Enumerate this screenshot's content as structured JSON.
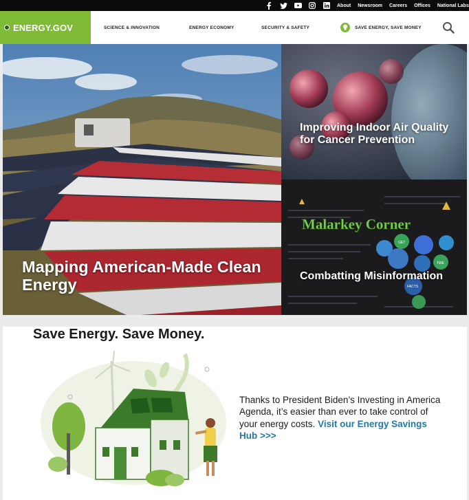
{
  "utility_nav": {
    "social": [
      "facebook-icon",
      "twitter-icon",
      "youtube-icon",
      "instagram-icon",
      "linkedin-icon"
    ],
    "links": [
      "About",
      "Newsroom",
      "Careers",
      "Offices",
      "National Labs"
    ]
  },
  "header": {
    "logo": "ENERGY.GOV",
    "nav": [
      "SCIENCE & INNOVATION",
      "ENERGY ECONOMY",
      "SECURITY & SAFETY"
    ],
    "save_nav": "SAVE ENERGY, SAVE MONEY",
    "search_icon": "search-icon"
  },
  "hero": {
    "main": "Mapping American-Made Clean Energy",
    "top_right": "Improving Indoor Air Quality for Cancer Prevention",
    "bottom_right": "Combatting Misinformation",
    "malarkey": "Malarkey Corner",
    "bubbles": [
      "GET",
      "TWE",
      "FACTS"
    ]
  },
  "save": {
    "title": "Save Energy. Save Money.",
    "text": "Thanks to President Biden’s Investing in America Agenda, it’s easier than ever to take control of your energy costs. ",
    "link": "Visit our Energy Savings Hub >>>"
  },
  "colors": {
    "green": "#7fbb35",
    "link": "#2378a6",
    "dark": "#0b0b0b"
  }
}
